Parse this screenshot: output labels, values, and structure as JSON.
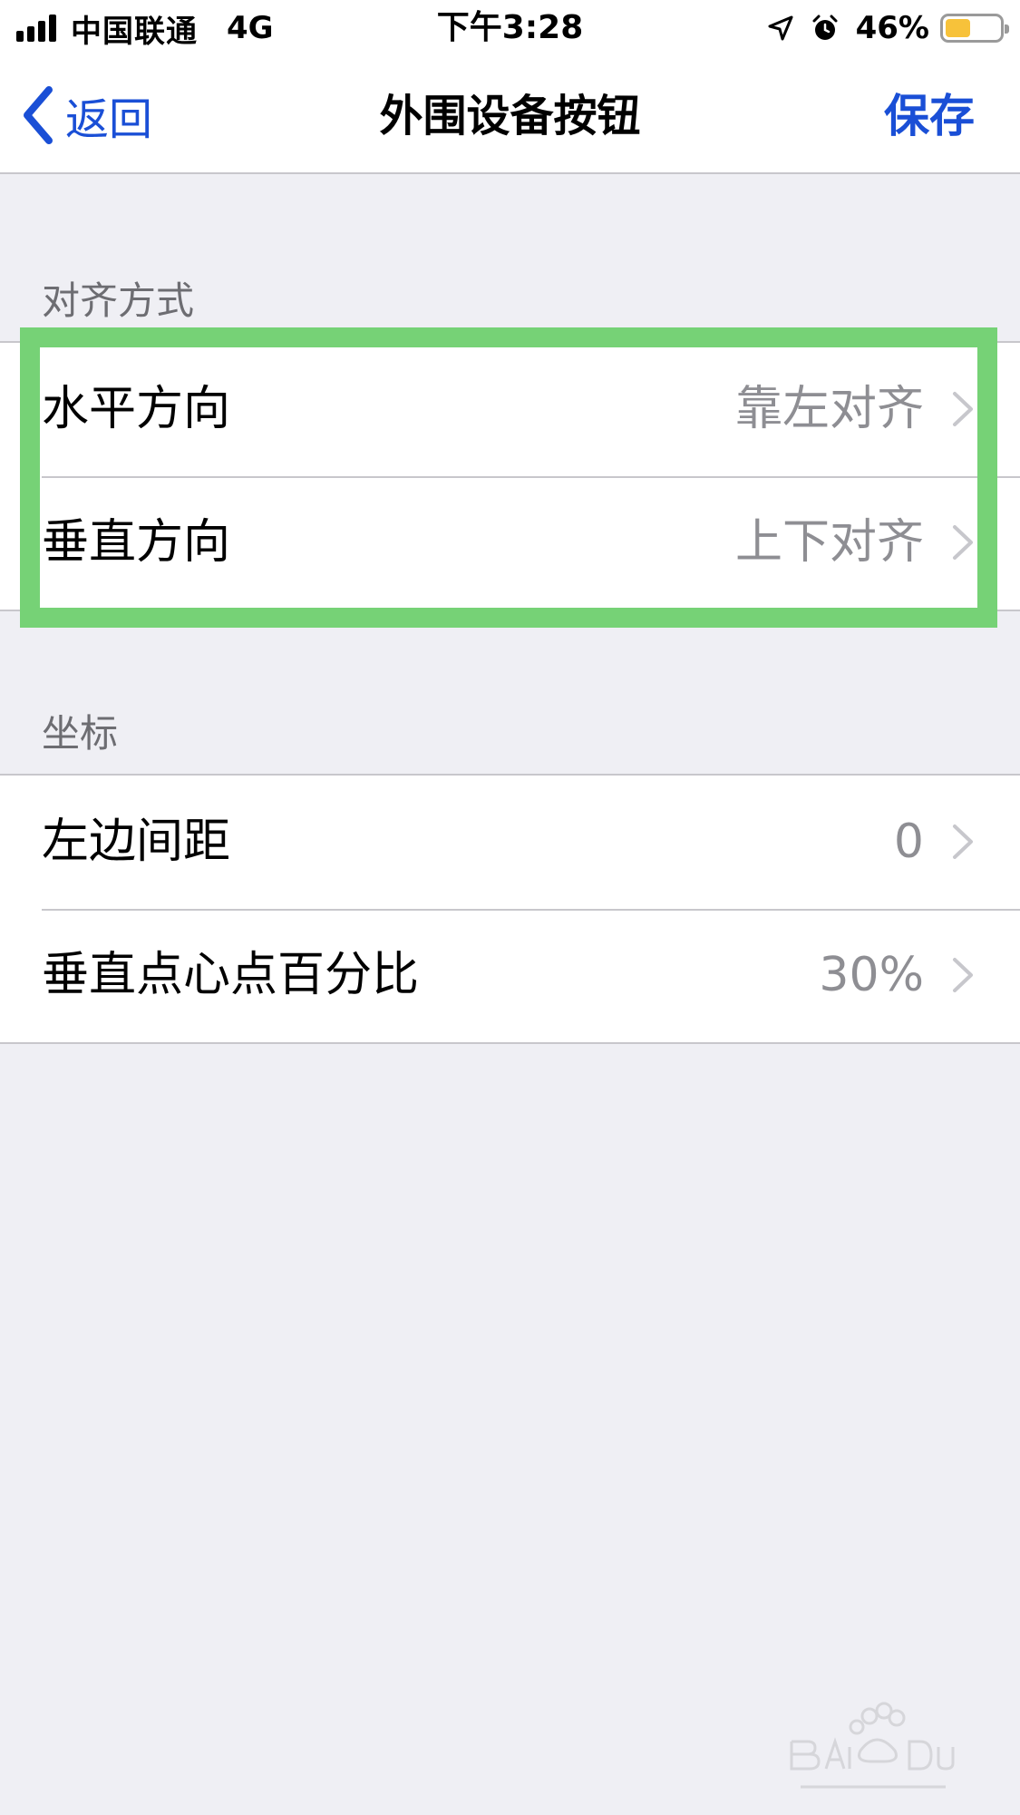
{
  "status_bar": {
    "carrier": "中国联通",
    "network": "4G",
    "time": "下午3:28",
    "battery_percent": "46%",
    "battery_level": 0.46,
    "icons": [
      "signal-bars-icon",
      "location-arrow-icon",
      "alarm-clock-icon",
      "battery-icon"
    ]
  },
  "nav": {
    "back_label": "返回",
    "title": "外围设备按钮",
    "save_label": "保存"
  },
  "sections": [
    {
      "header": "对齐方式",
      "rows": [
        {
          "label": "水平方向",
          "value": "靠左对齐"
        },
        {
          "label": "垂直方向",
          "value": "上下对齐"
        }
      ]
    },
    {
      "header": "坐标",
      "rows": [
        {
          "label": "左边间距",
          "value": "0"
        },
        {
          "label": "垂直点心点百分比",
          "value": "30%"
        }
      ]
    }
  ],
  "colors": {
    "accent": "#1a4fd6",
    "highlight": "#76d276",
    "background": "#efeff4",
    "secondary_text": "#8e8e93"
  }
}
